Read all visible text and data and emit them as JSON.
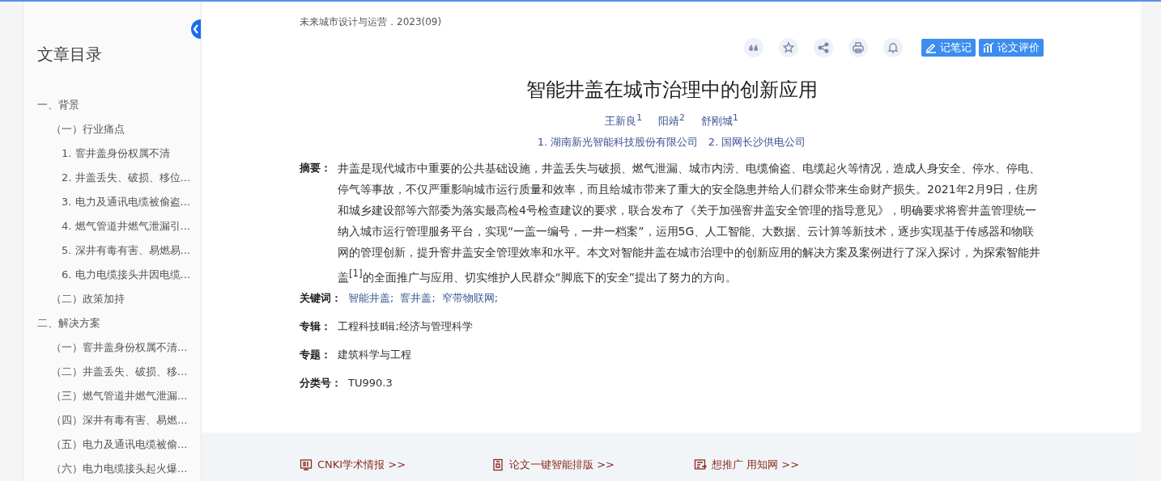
{
  "toc": {
    "title": "文章目录",
    "items": [
      {
        "label": "一、背景",
        "children": [
          {
            "label": "（一）行业痛点",
            "children": [
              {
                "label": "1. 窨井盖身份权属不清"
              },
              {
                "label": "2. 井盖丢失、破损、移位..."
              },
              {
                "label": "3. 电力及通讯电缆被偷盗..."
              },
              {
                "label": "4. 燃气管道井燃气泄漏引..."
              },
              {
                "label": "5. 深井有毒有害、易燃易..."
              },
              {
                "label": "6. 电力电缆接头井因电缆..."
              }
            ]
          },
          {
            "label": "（二）政策加持"
          }
        ]
      },
      {
        "label": "二、解决方案",
        "children": [
          {
            "label": "（一）窨井盖身份权属不清..."
          },
          {
            "label": "（二）井盖丢失、破损、移..."
          },
          {
            "label": "（三）燃气管道井燃气泄漏..."
          },
          {
            "label": "（四）深井有毒有害、易燃..."
          },
          {
            "label": "（五）电力及通讯电缆被偷..."
          },
          {
            "label": "（六）电力电缆接头起火爆..."
          }
        ]
      }
    ]
  },
  "source": "未来城市设计与运营．2023(09)",
  "toolbar": {
    "icons": [
      {
        "kind": "quote"
      },
      {
        "kind": "star"
      },
      {
        "kind": "share"
      },
      {
        "kind": "print"
      },
      {
        "kind": "bell"
      }
    ],
    "buttons": [
      {
        "kind": "note",
        "label": "记笔记"
      },
      {
        "kind": "rate",
        "label": "论文评价"
      }
    ]
  },
  "title": "智能井盖在城市治理中的创新应用",
  "authors": [
    "王新良$^{1}$",
    "阳靖$^{2}$",
    "舒刚城$^{1}$"
  ],
  "affiliations": "1. 湖南新光智能科技股份有限公司   2. 国网长沙供电公司",
  "abstract": {
    "label": "摘要：",
    "text": "井盖是现代城市中重要的公共基础设施，井盖丢失与破损、燃气泄漏、城市内涝、电缆偷盗、电缆起火等情况，造成人身安全、停水、停电、停气等事故，不仅严重影响城市运行质量和效率，而且给城市带来了重大的安全隐患并给人们群众带来生命财产损失。2021年2月9日，住房和城乡建设部等六部委为落实最高检4号检查建议的要求，联合发布了《关于加强窨井盖安全管理的指导意见》，明确要求将窨井盖管理统一纳入城市运行管理服务平台，实现“一盖一编号，一井一档案”，运用5G、人工智能、大数据、云计算等新技术，逐步实现基于传感器和物联网的管理创新，提升窨井盖安全管理效率和水平。本文对智能井盖在城市治理中的创新应用的解决方案及案例进行了深入探讨，为探索智能井盖$^{[1]}$的全面推广与应用、切实维护人民群众“脚底下的安全”提出了努力的方向。"
  },
  "keywords": {
    "label": "关键词：",
    "items": [
      "智能井盖;",
      "窨井盖;",
      "窄带物联网;"
    ]
  },
  "fields": [
    {
      "label": "专辑：",
      "value": "工程科技Ⅱ辑;经济与管理科学"
    },
    {
      "label": "专题：",
      "value": "建筑科学与工程"
    },
    {
      "label": "分类号：",
      "value": "TU990.3"
    }
  ],
  "footer_links": [
    {
      "kind": "monitor",
      "label": "CNKI学术情报 >>"
    },
    {
      "kind": "doc",
      "label": "论文一键智能排版 >>"
    },
    {
      "kind": "promo",
      "label": "想推广 用知网 >>"
    }
  ]
}
